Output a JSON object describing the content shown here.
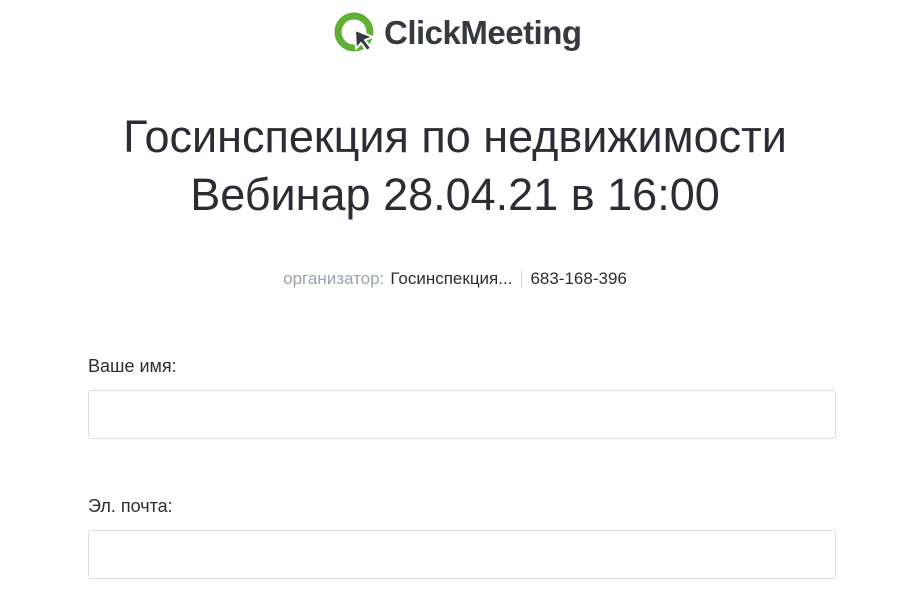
{
  "brand": {
    "logo_text": "ClickMeeting",
    "logo_icon": "clickmeeting-logo-icon",
    "accent_color": "#5eb135"
  },
  "event": {
    "title_line1": "Госинспекция по недвижимости",
    "title_line2": "Вебинар 28.04.21 в 16:00"
  },
  "meta": {
    "organizer_label": "организатор:",
    "organizer_name": "Госинспекция...",
    "room_id": "683-168-396"
  },
  "form": {
    "name_label": "Ваше имя:",
    "name_value": "",
    "email_label": "Эл. почта:",
    "email_value": ""
  }
}
